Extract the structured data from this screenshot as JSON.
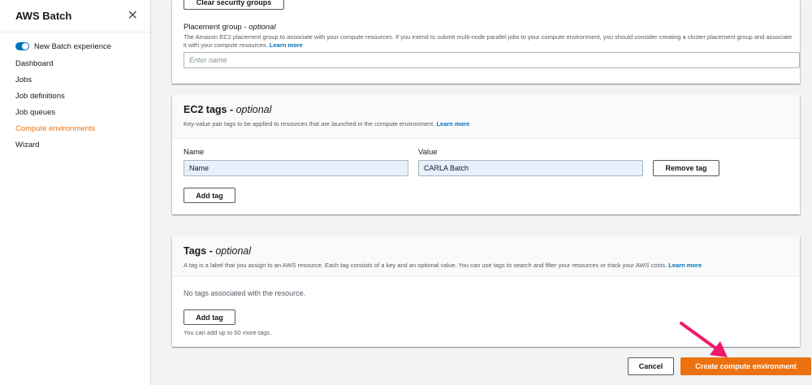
{
  "sidebar": {
    "title": "AWS Batch",
    "toggle_label": "New Batch experience",
    "items": [
      {
        "label": "Dashboard"
      },
      {
        "label": "Jobs"
      },
      {
        "label": "Job definitions"
      },
      {
        "label": "Job queues"
      },
      {
        "label": "Compute environments"
      },
      {
        "label": "Wizard"
      }
    ],
    "active_item": "Compute environments"
  },
  "top_card": {
    "clear_sg_button": "Clear security groups",
    "placement_label": "Placement group",
    "placement_optional": "optional",
    "placement_desc": "The Amazon EC2 placement group to associate with your compute resources. If you intend to submit multi-node parallel jobs to your compute environment, you should consider creating a cluster placement group and associate it with your compute resources.",
    "placement_learn_more": "Learn more",
    "placement_placeholder": "Enter name"
  },
  "ec2_tags": {
    "title": "EC2 tags",
    "optional": "optional",
    "desc": "Key-value pair tags to be applied to resources that are launched in the compute environment.",
    "learn_more": "Learn more",
    "name_label": "Name",
    "value_label": "Value",
    "name_value": "Name",
    "value_value": "CARLA Batch",
    "remove_button": "Remove tag",
    "add_button": "Add tag"
  },
  "tags": {
    "title": "Tags",
    "optional": "optional",
    "desc": "A tag is a label that you assign to an AWS resource. Each tag consists of a key and an optional value. You can use tags to search and filter your resources or track your AWS costs.",
    "learn_more": "Learn more",
    "empty_text": "No tags associated with the resource.",
    "add_button": "Add tag",
    "limit_text": "You can add up to 50 more tags."
  },
  "footer": {
    "cancel_button": "Cancel",
    "create_button": "Create compute environment"
  },
  "colors": {
    "accent": "#ec7211",
    "link": "#0073bb",
    "annotation_arrow": "#f0196b"
  }
}
